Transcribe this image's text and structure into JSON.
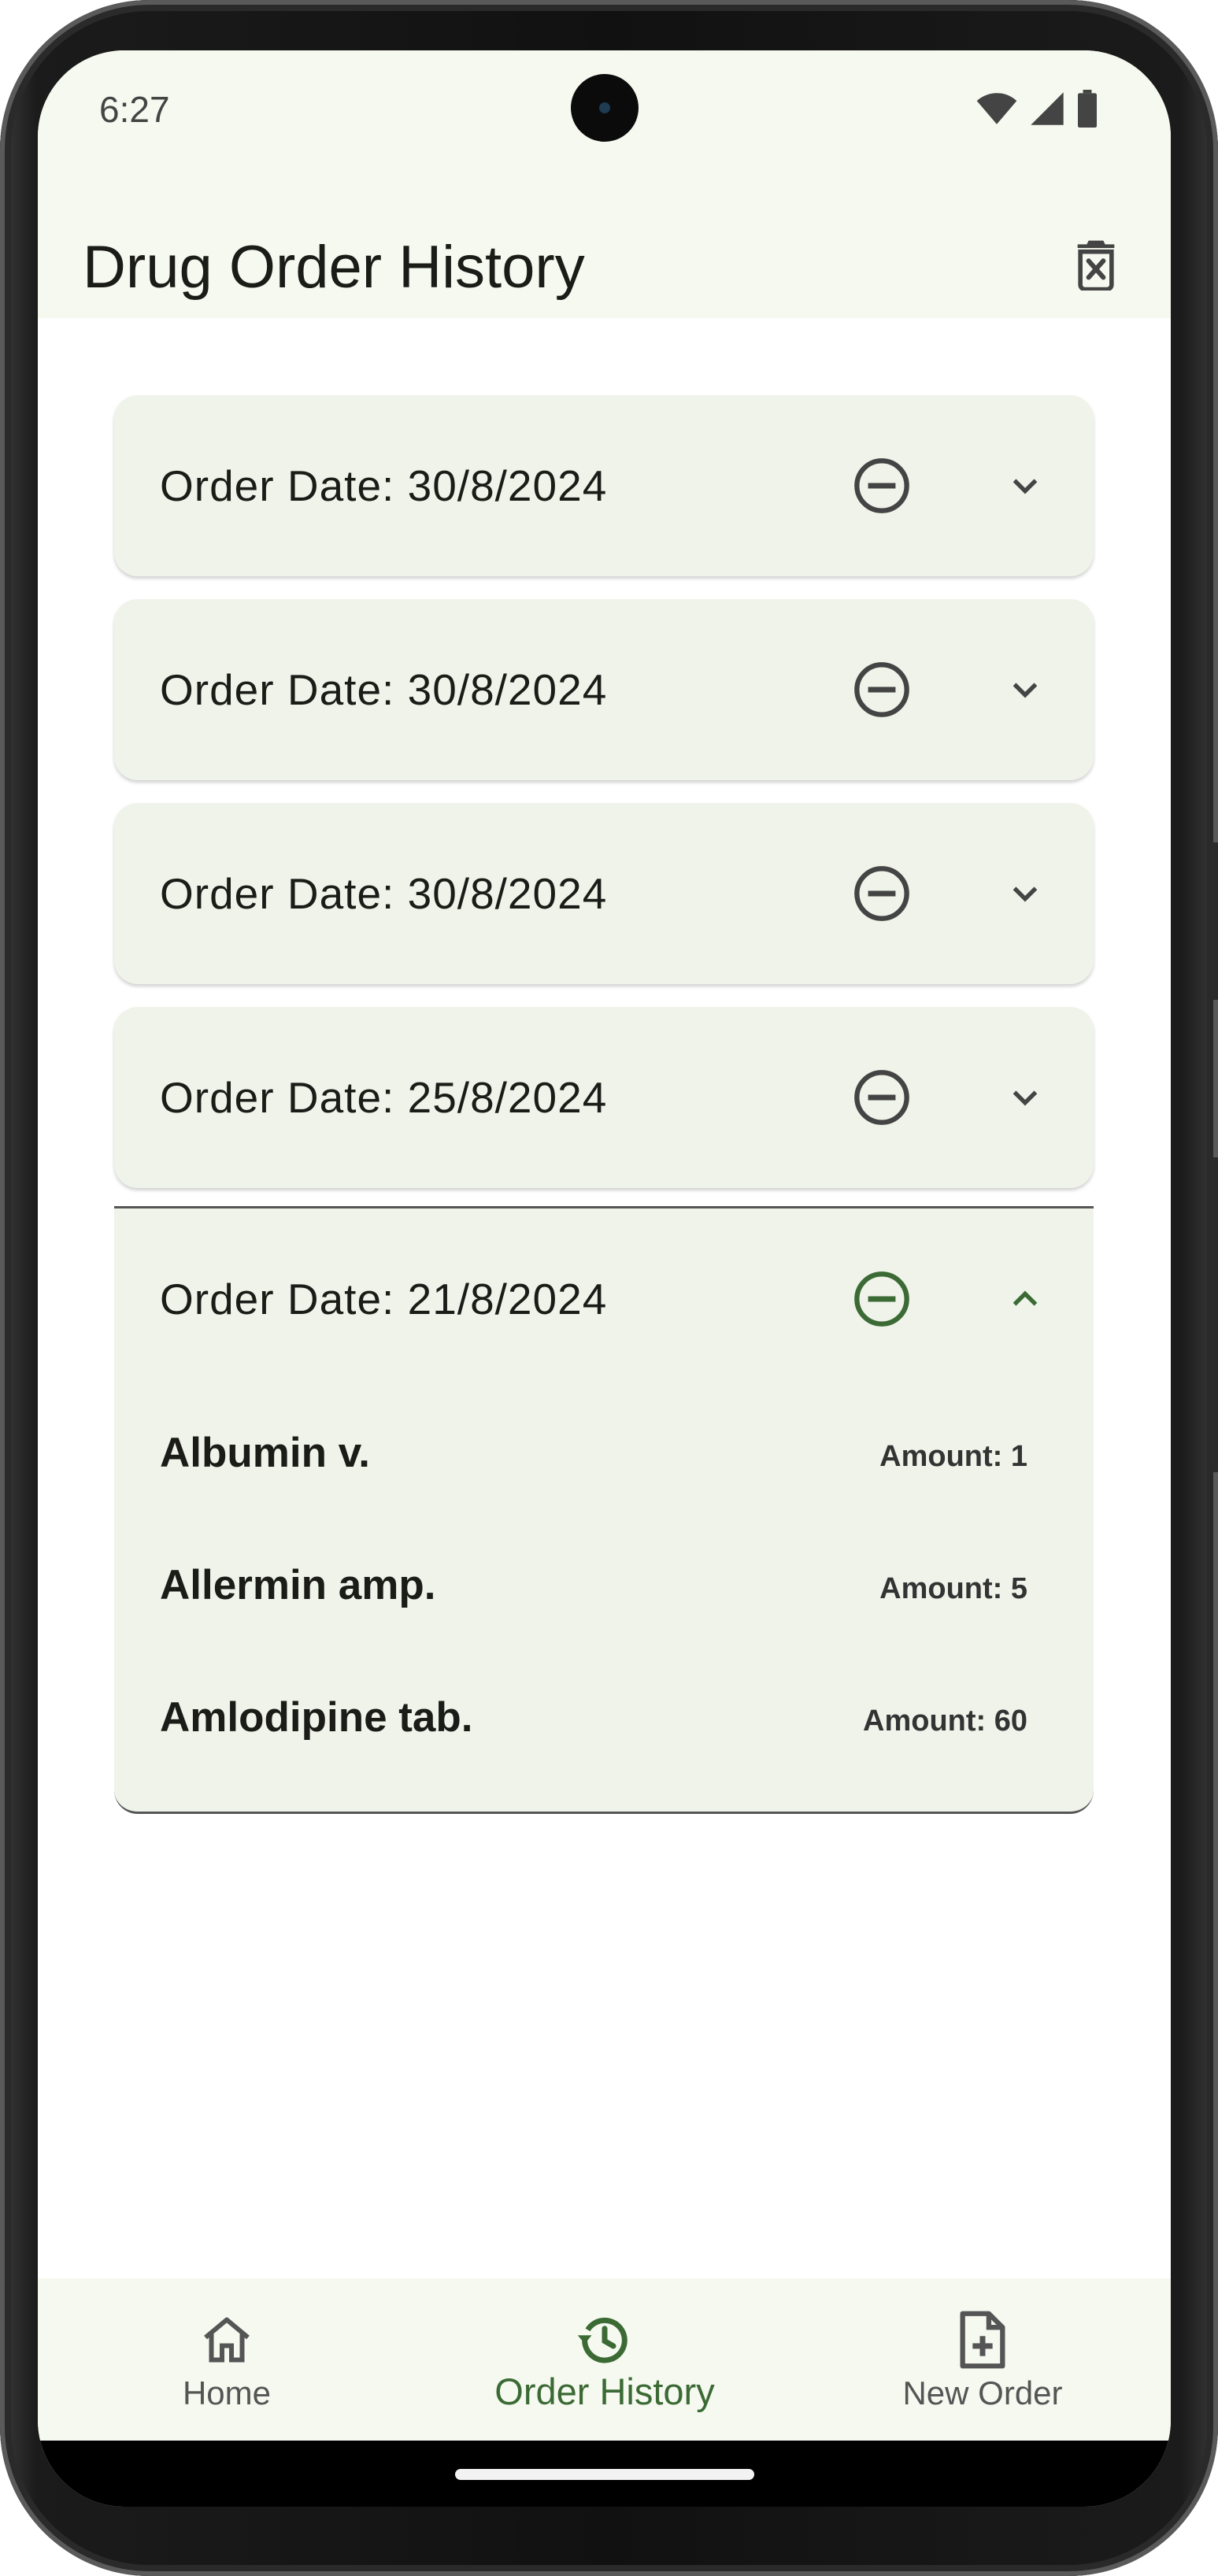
{
  "status_bar": {
    "time": "6:27"
  },
  "app_bar": {
    "title": "Drug Order History"
  },
  "orders": [
    {
      "date_label": "Order Date: 30/8/2024",
      "expanded": false,
      "items": []
    },
    {
      "date_label": "Order Date: 30/8/2024",
      "expanded": false,
      "items": []
    },
    {
      "date_label": "Order Date: 30/8/2024",
      "expanded": false,
      "items": []
    },
    {
      "date_label": "Order Date: 25/8/2024",
      "expanded": false,
      "items": []
    },
    {
      "date_label": "Order Date: 21/8/2024",
      "expanded": true,
      "items": [
        {
          "name": "Albumin v.",
          "amount": "Amount: 1"
        },
        {
          "name": "Allermin amp.",
          "amount": "Amount: 5"
        },
        {
          "name": "Amlodipine tab.",
          "amount": "Amount: 60"
        }
      ]
    }
  ],
  "bottom_nav": {
    "items": [
      {
        "label": "Home",
        "icon": "home-icon",
        "active": false
      },
      {
        "label": "Order History",
        "icon": "history-icon",
        "active": true
      },
      {
        "label": "New Order",
        "icon": "note-add-icon",
        "active": false
      }
    ]
  },
  "colors": {
    "surface": "#f6f9f0",
    "card": "#f0f3ea",
    "accent": "#3b6a35",
    "icon": "#444444"
  }
}
